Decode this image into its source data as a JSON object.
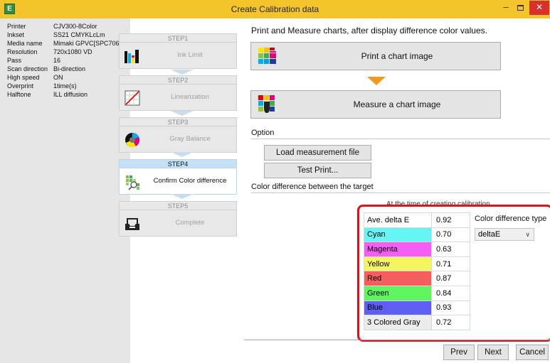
{
  "window": {
    "app_icon_letter": "E",
    "title": "Create Calibration data",
    "minimize_glyph": "–",
    "close_glyph": "✕"
  },
  "info": [
    {
      "key": "Printer",
      "value": "CJV300-8Color"
    },
    {
      "key": "Inkset",
      "value": "SS21 CMYKLcLm"
    },
    {
      "key": "Media name",
      "value": "Mimaki GPVC[SPC706]"
    },
    {
      "key": "Resolution",
      "value": "720x1080 VD"
    },
    {
      "key": "Pass",
      "value": "16"
    },
    {
      "key": "Scan direction",
      "value": "Bi-direction"
    },
    {
      "key": "High speed",
      "value": "ON"
    },
    {
      "key": "Overprint",
      "value": "1time(s)"
    },
    {
      "key": "Halftone",
      "value": "ILL diffusion"
    }
  ],
  "steps": [
    {
      "head": "STEP1",
      "label": "Ink Limit",
      "icon": "ink-limit-icon"
    },
    {
      "head": "STEP2",
      "label": "Linearization",
      "icon": "linearization-icon"
    },
    {
      "head": "STEP3",
      "label": "Gray Balance",
      "icon": "gray-balance-icon"
    },
    {
      "head": "STEP4",
      "label": "Confirm Color difference",
      "icon": "color-difference-icon",
      "active": true
    },
    {
      "head": "STEP5",
      "label": "Complete",
      "icon": "complete-icon"
    }
  ],
  "main": {
    "heading": "Print and Measure charts, after display difference color values.",
    "print_button": "Print a chart image",
    "measure_button": "Measure a chart image",
    "option_title": "Option",
    "load_button": "Load measurement file",
    "test_print_button": "Test Print...",
    "color_diff_title": "Color difference between the target",
    "obscured_text": "At the time of creating calibration"
  },
  "color_table": {
    "rows": [
      {
        "name": "Ave. delta E",
        "value": "0.92",
        "color": "#ffffff"
      },
      {
        "name": "Cyan",
        "value": "0.70",
        "color": "#66f5f5"
      },
      {
        "name": "Magenta",
        "value": "0.63",
        "color": "#f55ef5"
      },
      {
        "name": "Yellow",
        "value": "0.71",
        "color": "#f5f561"
      },
      {
        "name": "Red",
        "value": "0.87",
        "color": "#f55e5e"
      },
      {
        "name": "Green",
        "value": "0.84",
        "color": "#5ef55e"
      },
      {
        "name": "Blue",
        "value": "0.93",
        "color": "#5e5ef5"
      },
      {
        "name": "3 Colored Gray",
        "value": "0.72",
        "color": "#ececec"
      }
    ],
    "type_label": "Color difference type",
    "type_selected": "deltaE"
  },
  "nav": {
    "prev": "Prev",
    "next": "Next",
    "cancel": "Cancel"
  },
  "colors": {
    "title_bar": "#f3c52a",
    "accent_step": "#c5e0f7",
    "highlight": "#e3101c",
    "arrow_orange": "#f29a1d"
  }
}
